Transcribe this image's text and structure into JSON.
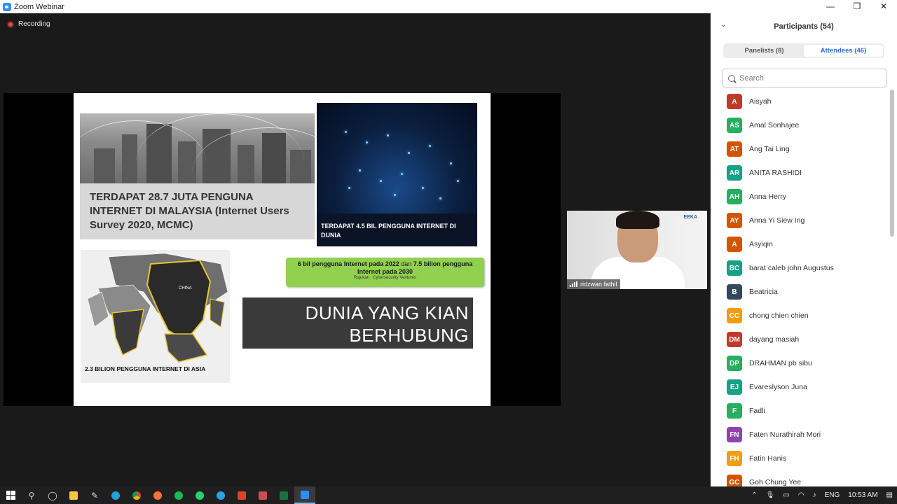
{
  "window": {
    "title": "Zoom Webinar",
    "minimize": "—",
    "maximize": "❐",
    "close": "✕"
  },
  "recording": {
    "label": "Recording"
  },
  "slide": {
    "malaysia_text": "TERDAPAT 28.7 JUTA PENGUNA INTERNET DI MALAYSIA (Internet Users Survey 2020, MCMC)",
    "world_label": "TERDAPAT 4.5 BIL PENGGUNA INTERNET DI DUNIA",
    "asia_label": "2.3 BILION PENGGUNA INTERNET DI ASIA",
    "map_label": "CHINA",
    "green_main_a": "6 bil pengguna Internet pada 2022",
    "green_main_b": "dan",
    "green_main_c": "7.5 bilion pengguna Internet pada 2030",
    "green_ref": "Rujukan : Cybersecurity Ventures",
    "title_line1": "DUNIA YANG KIAN",
    "title_line2": "BERHUBUNG"
  },
  "video": {
    "name": "ridzwan fathil",
    "logo": "EEKA"
  },
  "panel": {
    "collapse_icon": "⌄",
    "title": "Participants (54)",
    "tabs": [
      {
        "label": "Panelists (8)",
        "active": false
      },
      {
        "label": "Attendees (46)",
        "active": true
      }
    ],
    "search_placeholder": "Search",
    "participants": [
      {
        "initials": "A",
        "name": "Aisyah",
        "color": "#c0392b"
      },
      {
        "initials": "AS",
        "name": "Amal Sonhajee",
        "color": "#27ae60"
      },
      {
        "initials": "AT",
        "name": "Ang Tai Ling",
        "color": "#d35400"
      },
      {
        "initials": "AR",
        "name": "ANITA RASHIDI",
        "color": "#16a085"
      },
      {
        "initials": "AH",
        "name": "Anna Herry",
        "color": "#27ae60"
      },
      {
        "initials": "AY",
        "name": "Anna Yi Siew Ing",
        "color": "#d35400"
      },
      {
        "initials": "A",
        "name": "Asyiqin",
        "color": "#d35400"
      },
      {
        "initials": "BC",
        "name": "barat caleb john Augustus",
        "color": "#16a085"
      },
      {
        "initials": "B",
        "name": "Beatricia",
        "color": "#34495e"
      },
      {
        "initials": "CC",
        "name": "chong chien chien",
        "color": "#f39c12"
      },
      {
        "initials": "DM",
        "name": "dayang masiah",
        "color": "#c0392b"
      },
      {
        "initials": "DP",
        "name": "DRAHMAN pb sibu",
        "color": "#27ae60"
      },
      {
        "initials": "EJ",
        "name": "Evareslyson Juna",
        "color": "#16a085"
      },
      {
        "initials": "F",
        "name": "Fadli",
        "color": "#27ae60"
      },
      {
        "initials": "FN",
        "name": "Faten Nurathirah Mori",
        "color": "#8e44ad"
      },
      {
        "initials": "FH",
        "name": "Fatin Hanis",
        "color": "#f39c12"
      },
      {
        "initials": "GC",
        "name": "Goh Chung Yee",
        "color": "#d35400"
      }
    ]
  },
  "taskbar": {
    "language": "ENG",
    "time": "10:53 AM",
    "icons": [
      "windows-icon",
      "search-icon",
      "cortana-icon",
      "file-explorer-icon",
      "stylus-app-icon",
      "edge-icon",
      "chrome-icon",
      "firefox-icon",
      "spotify-icon",
      "whatsapp-icon",
      "telegram-icon",
      "powerpoint-icon",
      "app-icon",
      "excel-icon",
      "zoom-icon"
    ]
  }
}
